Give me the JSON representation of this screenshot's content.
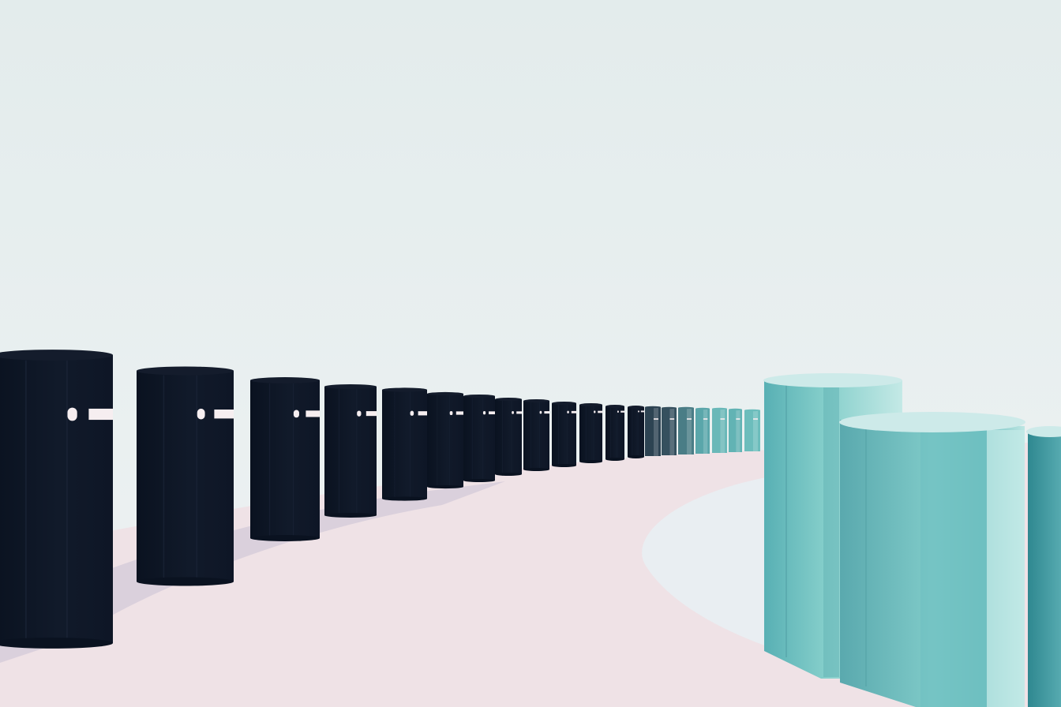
{
  "scene": {
    "description_visible_text": "",
    "colors": {
      "sky_top": "#e3ecec",
      "sky_bottom": "#edf2f3",
      "floor": "#efe2e6",
      "floor_shadow": "#d9cfdb",
      "pool": "#e9eef1",
      "pillar_dark": "#0c1424",
      "pillar_dark_highlight": "#1a2436",
      "pillar_cap_dark": "#141c2c",
      "slot_light": "#f6eef0",
      "teal_dark": "#3f9aa2",
      "teal_mid": "#76c7c6",
      "teal_light": "#bfe6e4",
      "teal_cap": "#cdeae9"
    },
    "objects": [
      {
        "kind": "dark-pillar-row",
        "count": 14
      },
      {
        "kind": "transition-pillar-row",
        "count": 7
      },
      {
        "kind": "teal-pillar-cluster",
        "count": 3
      }
    ]
  }
}
